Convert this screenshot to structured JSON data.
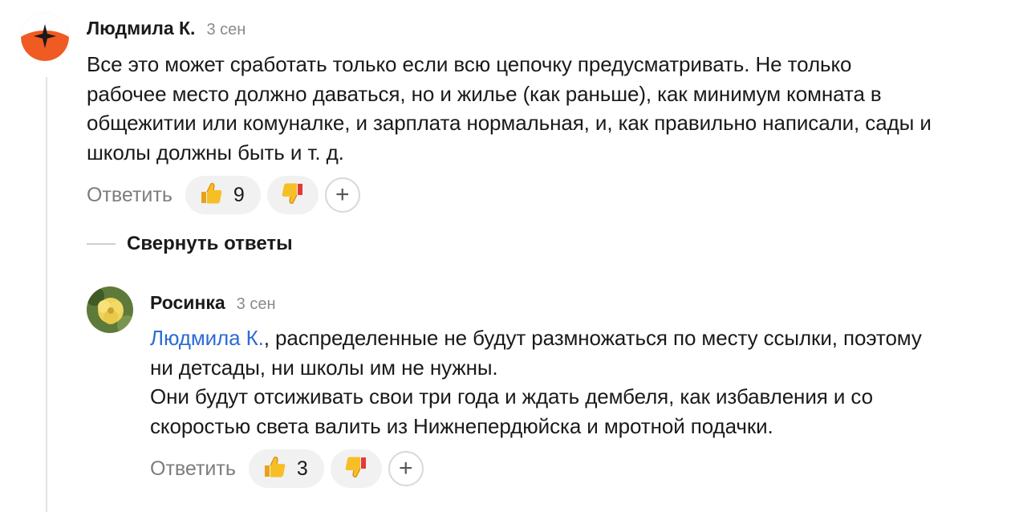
{
  "comments": [
    {
      "author": "Людмила К.",
      "date": "3 сен",
      "lines": [
        "Все это может сработать только если всю цепочку предусматривать. Не только",
        "рабочее место должно даваться, но и жилье (как раньше), как минимум комната в",
        "общежитии или комуналке, и зарплата нормальная, и, как правильно написали, сады и",
        "школы должны быть и т. д."
      ],
      "reply_label": "Ответить",
      "likes": "9"
    },
    {
      "author": "Росинка",
      "date": "3 сен",
      "mention": "Людмила К.",
      "line1_rest": ", распределенные не будут размножаться по месту ссылки, поэтому",
      "lines": [
        "ни детсады, ни школы им не нужны.",
        "Они будут отсиживать свои три года и ждать дембеля, как избавления и со",
        "скоростью света валить из Нижнепердюйска и мротной подачки."
      ],
      "reply_label": "Ответить",
      "likes": "3"
    }
  ],
  "collapse_label": "Свернуть ответы",
  "add_reaction_symbol": "+",
  "colors": {
    "mention": "#2b6bd6",
    "muted": "#8a8a8a",
    "pill_bg": "#f1f1f1",
    "avatar_orange": "#f05a23"
  },
  "icons": [
    "avatar-star-icon",
    "thumbs-up-icon",
    "thumbs-down-icon",
    "plus-icon"
  ]
}
